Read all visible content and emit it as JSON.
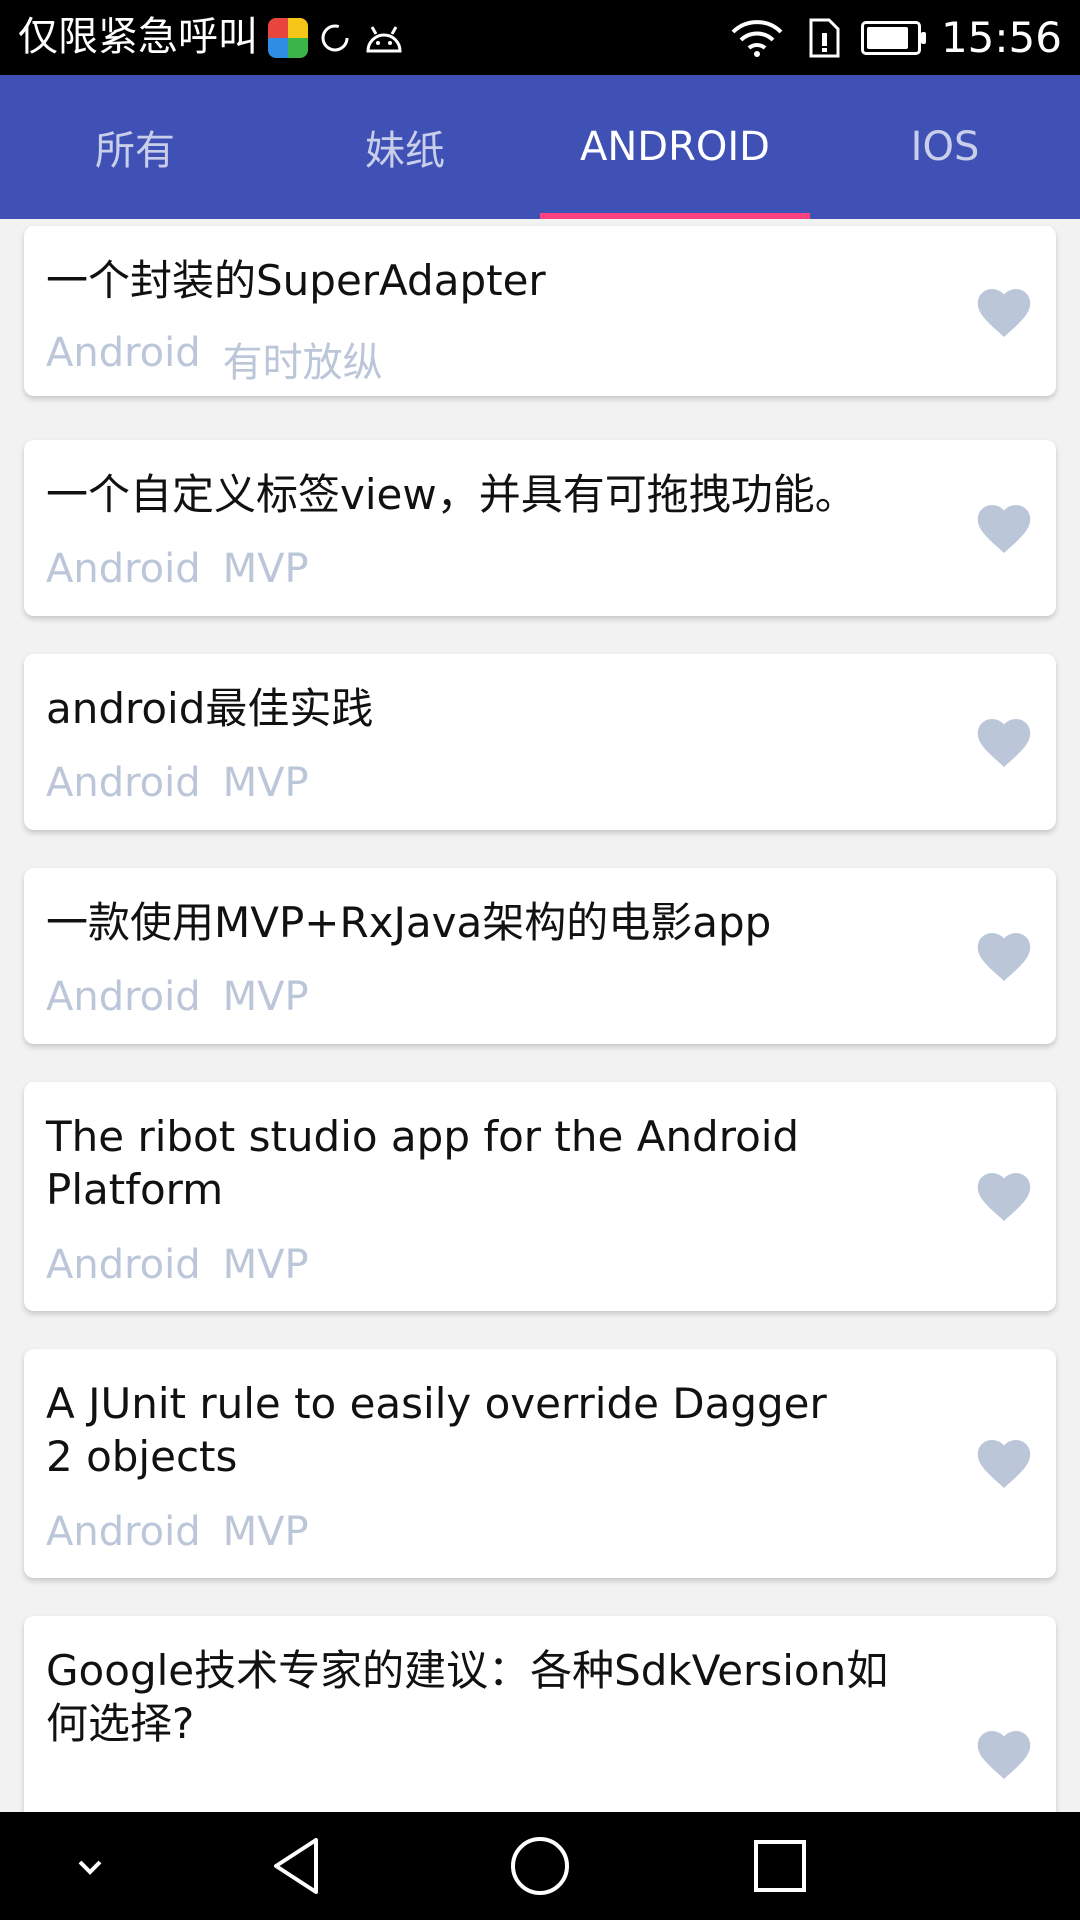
{
  "status_bar": {
    "left_text": "仅限紧急呼叫",
    "time": "15:56",
    "battery_level": 0.85,
    "icons": [
      "app-icon",
      "sync-icon",
      "android-icon",
      "wifi-icon",
      "sim-icon",
      "battery-icon"
    ]
  },
  "tabs": [
    {
      "label": "所有",
      "active": false
    },
    {
      "label": "妹纸",
      "active": false
    },
    {
      "label": "ANDROID",
      "active": true
    },
    {
      "label": "IOS",
      "active": false
    }
  ],
  "accent_color": "#3f51b5",
  "indicator_color": "#ff4081",
  "heart_color": "#bcc6d9",
  "cards": [
    {
      "title": "一个封装的SuperAdapter",
      "tag1": "Android",
      "tag2": "有时放纵"
    },
    {
      "title": "一个自定义标签view，并具有可拖拽功能。",
      "tag1": "Android",
      "tag2": "MVP"
    },
    {
      "title": "android最佳实践",
      "tag1": "Android",
      "tag2": "MVP"
    },
    {
      "title": "一款使用MVP+RxJava架构的电影app",
      "tag1": "Android",
      "tag2": "MVP"
    },
    {
      "title": "The ribot studio app for the Android Platform",
      "tag1": "Android",
      "tag2": "MVP"
    },
    {
      "title": "A JUnit rule to easily override Dagger 2 objects",
      "tag1": "Android",
      "tag2": "MVP"
    },
    {
      "title": "Google技术专家的建议：各种SdkVersion如何选择?",
      "tag1": "",
      "tag2": ""
    }
  ],
  "nav_bar": {
    "icons": [
      "chevron-down-icon",
      "back-icon",
      "home-icon",
      "recents-icon"
    ]
  }
}
